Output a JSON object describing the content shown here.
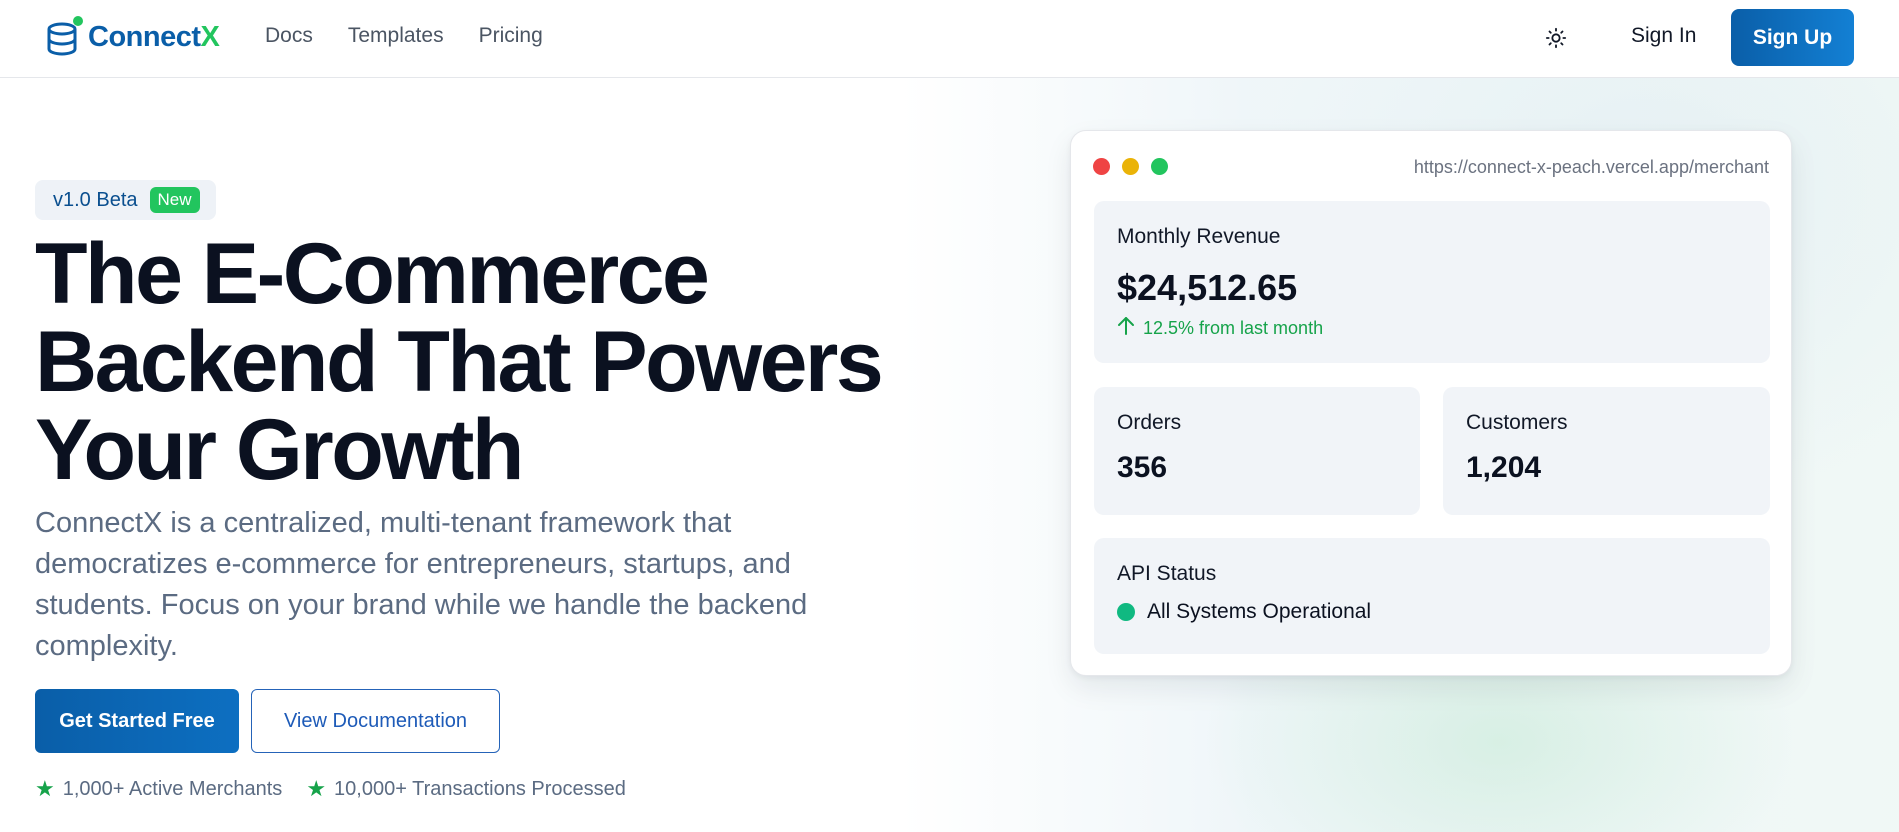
{
  "nav": {
    "brand_part1": "Connect",
    "brand_part2": "X",
    "links": [
      "Docs",
      "Templates",
      "Pricing"
    ],
    "theme_toggle_icon": "sun-icon",
    "sign_in": "Sign In",
    "sign_up": "Sign Up"
  },
  "hero": {
    "badge_text": "v1.0 Beta",
    "badge_tag": "New",
    "headline_lines": [
      "The E-Commerce",
      "Backend That Powers",
      "Your Growth"
    ],
    "subtext": "ConnectX is a centralized, multi-tenant framework that democratizes e-commerce for entrepreneurs, startups, and students. Focus on your brand while we handle the backend complexity.",
    "cta_primary": "Get Started Free",
    "cta_secondary": "View Documentation",
    "stats": [
      "1,000+ Active Merchants",
      "10,000+ Transactions Processed"
    ]
  },
  "dashboard": {
    "url": "https://connect-x-peach.vercel.app/merchant",
    "window_dots": [
      "#ef4444",
      "#eab308",
      "#22c55e"
    ],
    "revenue": {
      "label": "Monthly Revenue",
      "value": "$24,512.65",
      "change": "12.5% from last month"
    },
    "orders": {
      "label": "Orders",
      "value": "356"
    },
    "customers": {
      "label": "Customers",
      "value": "1,204"
    },
    "api_status": {
      "label": "API Status",
      "status": "All Systems Operational"
    }
  },
  "colors": {
    "brand_blue": "#0a5ea8",
    "brand_green": "#22c55e",
    "positive": "#16a34a",
    "status_ok": "#10b981"
  }
}
